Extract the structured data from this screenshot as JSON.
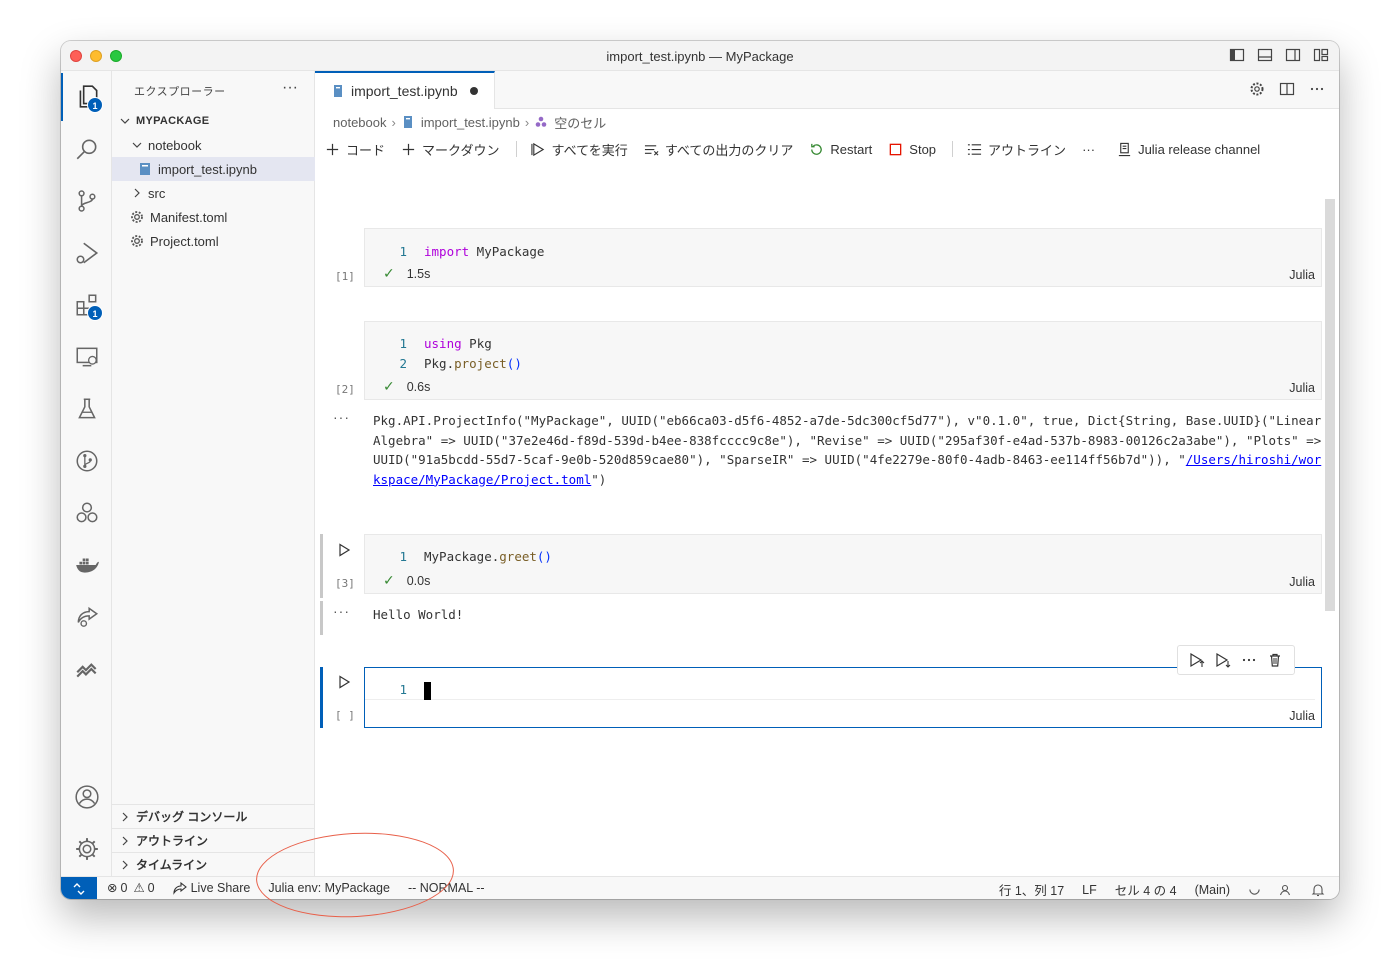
{
  "window": {
    "title": "import_test.ipynb — MyPackage"
  },
  "activity_bar": {
    "explorer_badge": "1",
    "extensions_badge": "1"
  },
  "sidebar": {
    "header": "エクスプローラー",
    "more": "···",
    "section_title": "MYPACKAGE",
    "tree": [
      {
        "label": "notebook",
        "type": "folder-open"
      },
      {
        "label": "import_test.ipynb",
        "type": "notebook-file"
      },
      {
        "label": "src",
        "type": "folder-closed"
      },
      {
        "label": "Manifest.toml",
        "type": "toml-file"
      },
      {
        "label": "Project.toml",
        "type": "toml-file"
      }
    ],
    "bottom_sections": [
      "デバッグ コンソール",
      "アウトライン",
      "タイムライン"
    ]
  },
  "tab": {
    "label": "import_test.ipynb"
  },
  "breadcrumb": {
    "folder": "notebook",
    "file": "import_test.ipynb",
    "cell": "空のセル"
  },
  "toolbar": {
    "add_code": "コード",
    "add_markdown": "マークダウン",
    "run_all": "すべてを実行",
    "clear_outputs": "すべての出力のクリア",
    "restart": "Restart",
    "stop": "Stop",
    "outline": "アウトライン",
    "more": "···",
    "kernel": "Julia release channel"
  },
  "cells": [
    {
      "exec_count": "[1]",
      "lines": [
        {
          "num": "1",
          "keyword": "import",
          "rest": " MyPackage"
        }
      ],
      "status_time": "1.5s",
      "language": "Julia"
    },
    {
      "exec_count": "[2]",
      "lines": [
        {
          "num": "1",
          "keyword": "using",
          "rest": " Pkg"
        },
        {
          "num": "2",
          "obj": "Pkg.",
          "fn": "project",
          "paren": "()"
        }
      ],
      "status_time": "0.6s",
      "language": "Julia",
      "output_text": "Pkg.API.ProjectInfo(\"MyPackage\", UUID(\"eb66ca03-d5f6-4852-a7de-5dc300cf5d77\"), v\"0.1.0\", true, Dict{String, Base.UUID}(\"LinearAlgebra\" => UUID(\"37e2e46d-f89d-539d-b4ee-838fcccc9c8e\"), \"Revise\" => UUID(\"295af30f-e4ad-537b-8983-00126c2a3abe\"), \"Plots\" => UUID(\"91a5bcdd-55d7-5caf-9e0b-520d859cae80\"), \"SparseIR\" => UUID(\"4fe2279e-80f0-4adb-8463-ee114ff56b7d\")), \"",
      "output_link": "/Users/hiroshi/workspace/MyPackage/Project.toml",
      "output_tail": "\")"
    },
    {
      "exec_count": "[3]",
      "lines": [
        {
          "num": "1",
          "obj": "MyPackage.",
          "fn": "greet",
          "paren": "()"
        }
      ],
      "status_time": "0.0s",
      "language": "Julia",
      "output_text": "Hello World!"
    },
    {
      "exec_count": "[ ]",
      "lines": [
        {
          "num": "1"
        }
      ],
      "language": "Julia"
    }
  ],
  "output_more": "···",
  "statusbar": {
    "errors": "0",
    "warnings": "0",
    "live_share": "Live Share",
    "julia_env": "Julia env: MyPackage",
    "vim_mode": "-- NORMAL --",
    "cursor_pos": "行 1、列 17",
    "eol": "LF",
    "cell_pos": "セル 4 の 4",
    "branch": "(Main)"
  },
  "colors": {
    "accent": "#005fb8",
    "annotation": "#e8604a",
    "keyword": "#af00db",
    "function": "#795e26",
    "check": "#388a34"
  }
}
